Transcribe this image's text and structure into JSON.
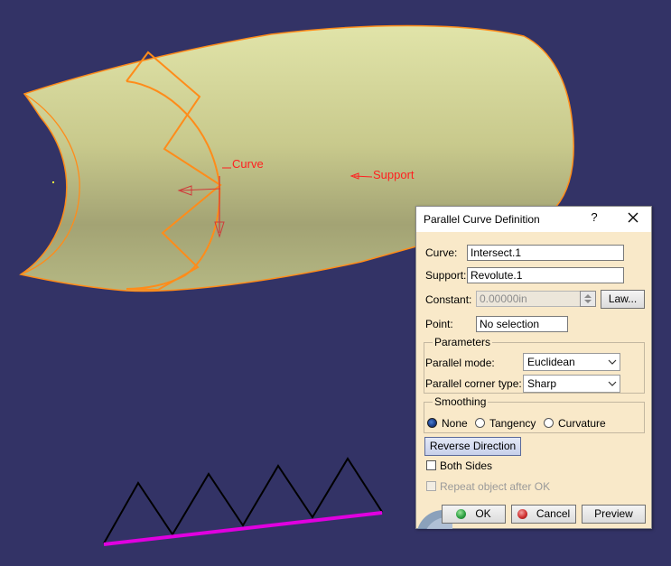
{
  "viewport": {
    "labels": {
      "curve": "Curve",
      "support": "Support"
    },
    "colors": {
      "background": "#333366",
      "surface": "#d9dba0",
      "highlight": "#ff8c1a",
      "label": "#ff2020",
      "result_curve": "#000000",
      "support_line": "#e000e0"
    }
  },
  "dialog": {
    "title": "Parallel Curve Definition",
    "help_label": "?",
    "curve_label": "Curve:",
    "curve_value": "Intersect.1",
    "support_label": "Support:",
    "support_value": "Revolute.1",
    "constant_label": "Constant:",
    "constant_value": "0.00000in",
    "law_button": "Law...",
    "point_label": "Point:",
    "point_value": "No selection",
    "parameters_title": "Parameters",
    "parallel_mode_label": "Parallel mode:",
    "parallel_mode_value": "Euclidean",
    "corner_type_label": "Parallel corner type:",
    "corner_type_value": "Sharp",
    "smoothing_title": "Smoothing",
    "smoothing_options": [
      "None",
      "Tangency",
      "Curvature"
    ],
    "smoothing_selected": "None",
    "reverse_button": "Reverse Direction",
    "both_sides_label": "Both Sides",
    "repeat_label": "Repeat object after OK",
    "ok_button": "OK",
    "cancel_button": "Cancel",
    "preview_button": "Preview",
    "colors": {
      "background": "#f9e9c9",
      "ok_dot": "#2ea043",
      "cancel_dot": "#d03030"
    }
  }
}
